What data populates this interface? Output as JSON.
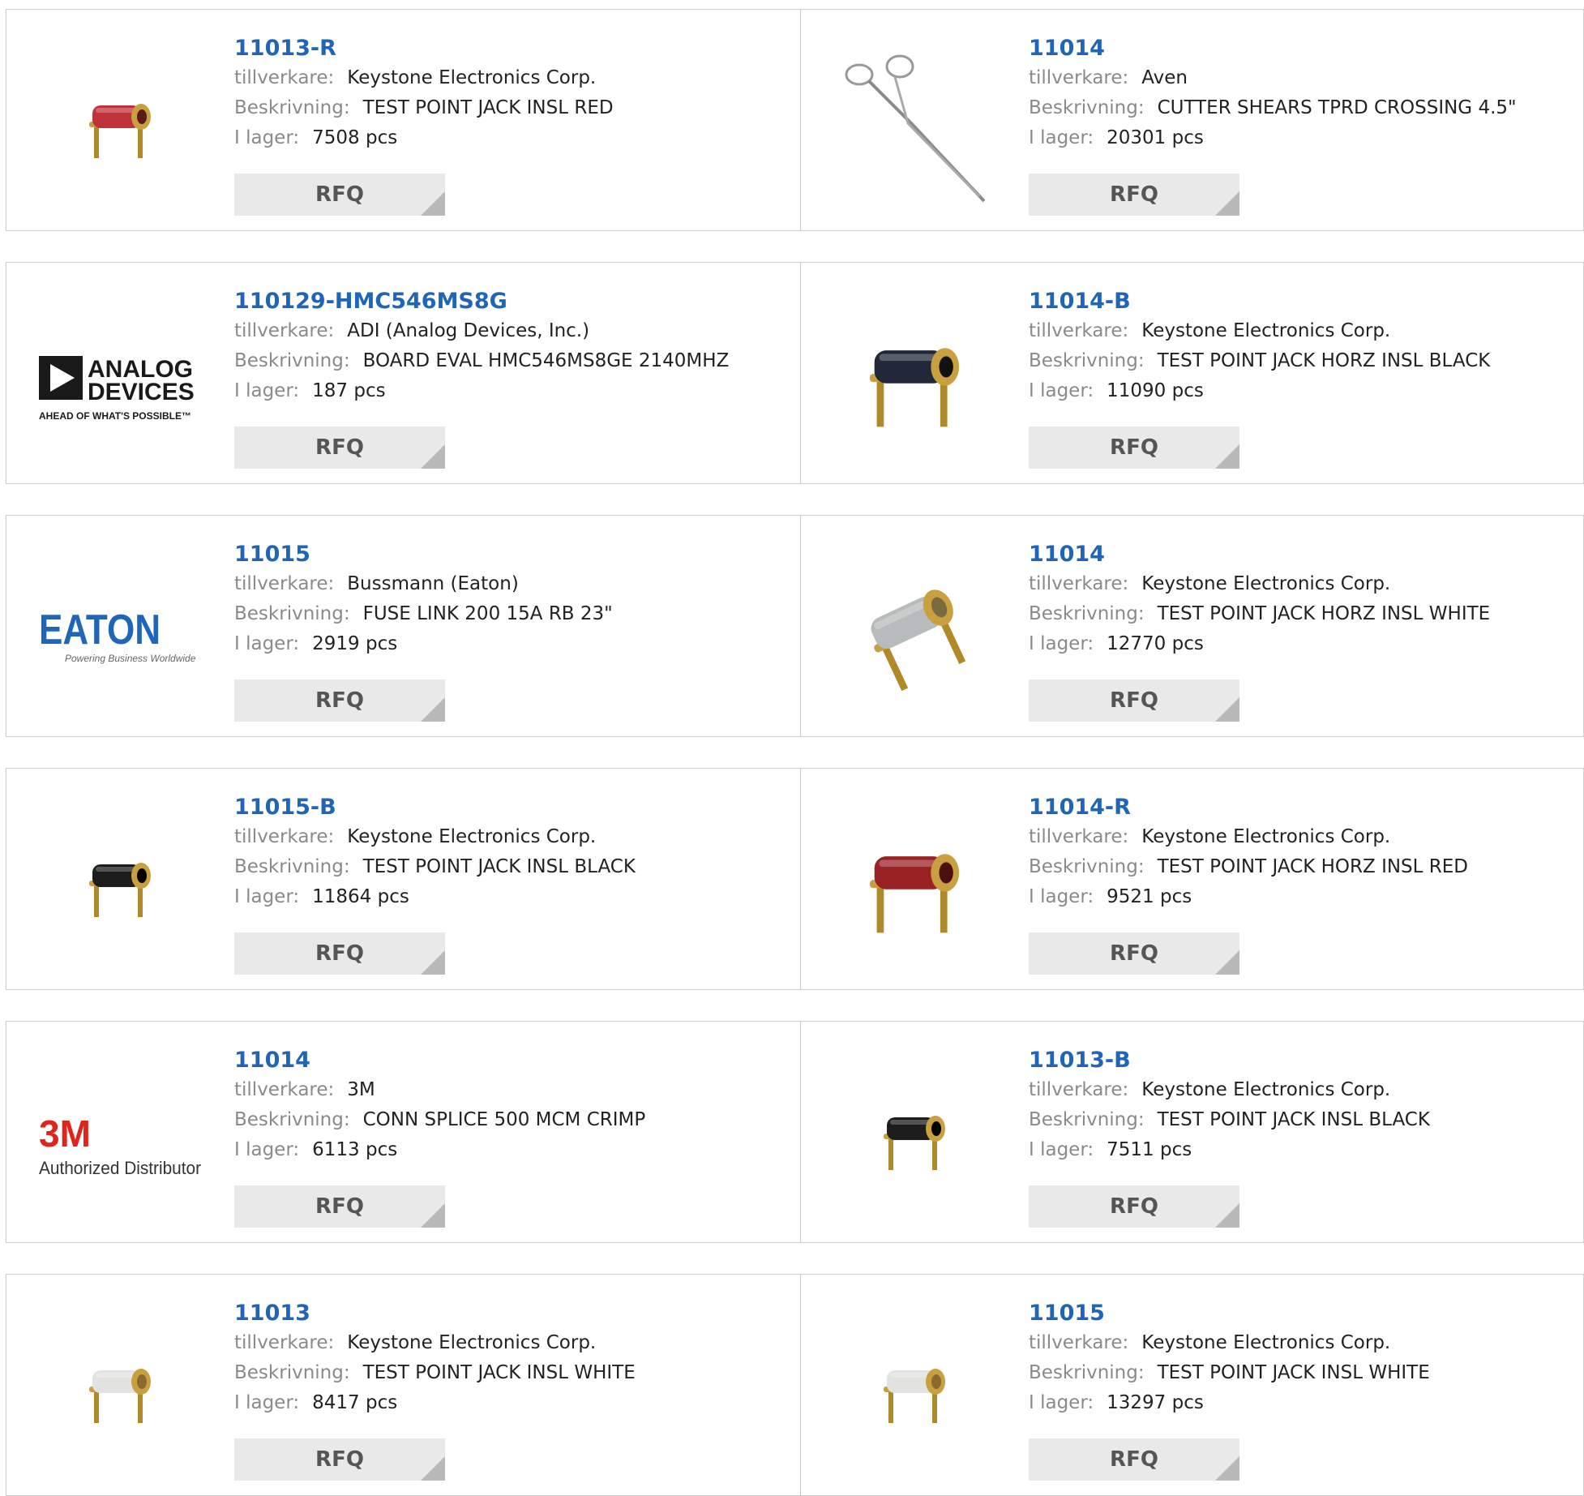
{
  "labels": {
    "manufacturer": "tillverkare:",
    "description": "Beskrivning:",
    "stock": "I lager:",
    "rfq": "RFQ"
  },
  "logos": {
    "adi_line1": "ANALOG",
    "adi_line2": "DEVICES",
    "adi_tagline": "AHEAD OF WHAT'S POSSIBLE™",
    "eaton_name": "EATON",
    "eaton_tagline": "Powering Business Worldwide",
    "m3_name": "3M",
    "m3_tagline": "Authorized Distributor"
  },
  "products": [
    {
      "part": "11013-R",
      "manufacturer": "Keystone Electronics Corp.",
      "description": "TEST POINT JACK INSL RED",
      "stock": "7508 pcs",
      "image": "test-jack-red-small"
    },
    {
      "part": "11014",
      "manufacturer": "Aven",
      "description": "CUTTER SHEARS TPRD CROSSING 4.5\"",
      "stock": "20301 pcs",
      "image": "scissors"
    },
    {
      "part": "110129-HMC546MS8G",
      "manufacturer": "ADI (Analog Devices, Inc.)",
      "description": "BOARD EVAL HMC546MS8GE 2140MHZ",
      "stock": "187 pcs",
      "image": "analog-devices-logo"
    },
    {
      "part": "11014-B",
      "manufacturer": "Keystone Electronics Corp.",
      "description": "TEST POINT JACK HORZ INSL BLACK",
      "stock": "11090 pcs",
      "image": "test-jack-black-large"
    },
    {
      "part": "11015",
      "manufacturer": "Bussmann (Eaton)",
      "description": "FUSE LINK 200 15A RB 23\"",
      "stock": "2919 pcs",
      "image": "eaton-logo"
    },
    {
      "part": "11014",
      "manufacturer": "Keystone Electronics Corp.",
      "description": "TEST POINT JACK HORZ INSL WHITE",
      "stock": "12770 pcs",
      "image": "test-jack-white-angled"
    },
    {
      "part": "11015-B",
      "manufacturer": "Keystone Electronics Corp.",
      "description": "TEST POINT JACK INSL BLACK",
      "stock": "11864 pcs",
      "image": "test-jack-black-small"
    },
    {
      "part": "11014-R",
      "manufacturer": "Keystone Electronics Corp.",
      "description": "TEST POINT JACK HORZ INSL RED",
      "stock": "9521 pcs",
      "image": "test-jack-red-large"
    },
    {
      "part": "11014",
      "manufacturer": "3M",
      "description": "CONN SPLICE 500 MCM CRIMP",
      "stock": "6113 pcs",
      "image": "3m-logo"
    },
    {
      "part": "11013-B",
      "manufacturer": "Keystone Electronics Corp.",
      "description": "TEST POINT JACK INSL BLACK",
      "stock": "7511 pcs",
      "image": "test-jack-black-small"
    },
    {
      "part": "11013",
      "manufacturer": "Keystone Electronics Corp.",
      "description": "TEST POINT JACK INSL WHITE",
      "stock": "8417 pcs",
      "image": "test-jack-white-small"
    },
    {
      "part": "11015",
      "manufacturer": "Keystone Electronics Corp.",
      "description": "TEST POINT JACK INSL WHITE",
      "stock": "13297 pcs",
      "image": "test-jack-white-small"
    }
  ]
}
